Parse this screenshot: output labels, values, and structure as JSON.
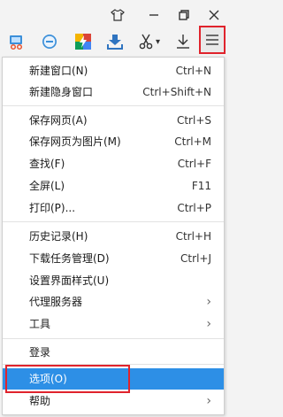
{
  "window_controls": {
    "skin_icon": "shirt-icon",
    "minimize_icon": "minimize-icon",
    "restore_icon": "restore-icon",
    "close_icon": "close-icon"
  },
  "toolbar": {
    "icons": [
      "screenshot-tool-icon",
      "minus-circle-icon",
      "app-store-icon",
      "download-manager-icon",
      "scissors-icon",
      "download-icon",
      "menu-icon"
    ],
    "scissors_dropdown": "▾"
  },
  "menu": {
    "groups": [
      [
        {
          "label": "新建窗口(N)",
          "shortcut": "Ctrl+N"
        },
        {
          "label": "新建隐身窗口",
          "shortcut": "Ctrl+Shift+N"
        }
      ],
      [
        {
          "label": "保存网页(A)",
          "shortcut": "Ctrl+S"
        },
        {
          "label": "保存网页为图片(M)",
          "shortcut": "Ctrl+M"
        },
        {
          "label": "查找(F)",
          "shortcut": "Ctrl+F"
        },
        {
          "label": "全屏(L)",
          "shortcut": "F11"
        },
        {
          "label": "打印(P)...",
          "shortcut": "Ctrl+P"
        }
      ],
      [
        {
          "label": "历史记录(H)",
          "shortcut": "Ctrl+H"
        },
        {
          "label": "下载任务管理(D)",
          "shortcut": "Ctrl+J"
        },
        {
          "label": "设置界面样式(U)",
          "shortcut": ""
        },
        {
          "label": "代理服务器",
          "shortcut": "",
          "submenu": true
        },
        {
          "label": "工具",
          "shortcut": "",
          "submenu": true
        }
      ],
      [
        {
          "label": "登录",
          "shortcut": ""
        },
        {
          "label": "选项(O)",
          "shortcut": "",
          "selected": true
        },
        {
          "label": "帮助",
          "shortcut": "",
          "submenu": true
        }
      ]
    ],
    "submenu_arrow": "›"
  },
  "colors": {
    "highlight": "#2d8fe6",
    "annotation": "#e0232c"
  }
}
